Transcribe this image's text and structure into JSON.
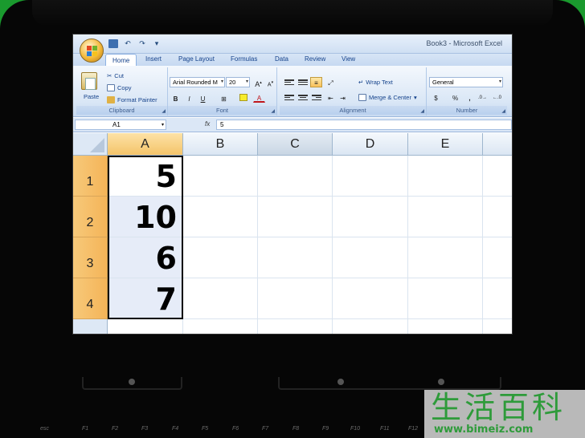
{
  "window": {
    "title": "Book3 - Microsoft Excel"
  },
  "tabs": [
    "Home",
    "Insert",
    "Page Layout",
    "Formulas",
    "Data",
    "Review",
    "View"
  ],
  "ribbon": {
    "clipboard": {
      "label": "Clipboard",
      "paste": "Paste",
      "cut": "Cut",
      "copy": "Copy",
      "format_painter": "Format Painter"
    },
    "font": {
      "label": "Font",
      "font_name": "Arial Rounded M",
      "font_size": "20",
      "bold": "B",
      "italic": "I",
      "underline": "U",
      "font_color_glyph": "A"
    },
    "alignment": {
      "label": "Alignment",
      "wrap_text": "Wrap Text",
      "merge_center": "Merge & Center"
    },
    "number": {
      "label": "Number",
      "format": "General",
      "percent": "%"
    }
  },
  "formula_bar": {
    "name_box": "A1",
    "fx": "fx",
    "formula": "5"
  },
  "sheet": {
    "columns": [
      "A",
      "B",
      "C",
      "D",
      "E"
    ],
    "rows": [
      "1",
      "2",
      "3",
      "4"
    ],
    "values_a": [
      "5",
      "10",
      "6",
      "7"
    ]
  },
  "keyboard": {
    "keys": [
      "esc",
      "F1",
      "F2",
      "F3",
      "F4",
      "F5",
      "F6",
      "F7",
      "F8",
      "F9",
      "F10",
      "F11",
      "F12"
    ]
  },
  "watermark": {
    "chinese": "生活百科",
    "url": "www.bimeiz.com"
  },
  "colors": {
    "accent": "#f4b458",
    "ribbon": "#dae7f6",
    "background": "#1a9a2e"
  }
}
